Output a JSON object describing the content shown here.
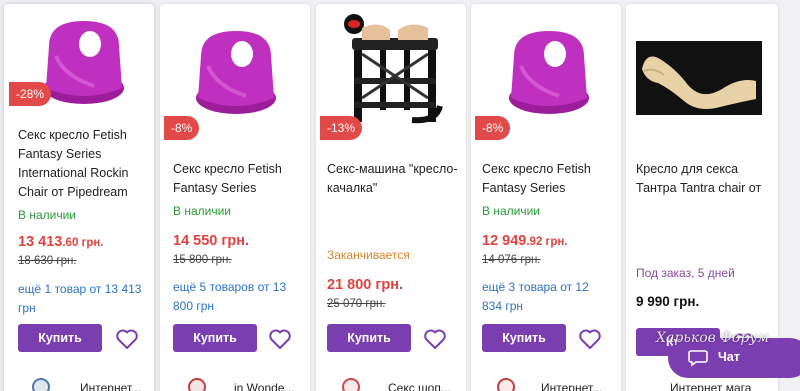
{
  "products": [
    {
      "badge": "-28%",
      "title": "Секс кресло Fetish Fantasy Series International Rockin Chair от Pipedream",
      "status": "В наличии",
      "price_main": "13 413",
      "price_cents": ".60 грн.",
      "old_price": "18 630 грн.",
      "offer": "ещё 1 товар от 13 413 грн",
      "buy_label": "Купить",
      "seller": "Интернет..."
    },
    {
      "badge": "-8%",
      "title": "Секс кресло Fetish Fantasy Series",
      "status": "В наличии",
      "price_main": "14 550 грн.",
      "old_price": "15 800 грн.",
      "offer": "ещё 5 товаров от 13 800 грн",
      "buy_label": "Купить",
      "seller": "in Wonde..."
    },
    {
      "badge": "-13%",
      "title": "Секс-машина \"кресло-качалка\"",
      "status": "Заканчивается",
      "price_main": "21 800 грн.",
      "old_price": "25 070 грн.",
      "buy_label": "Купить",
      "seller": "Секс шоп..."
    },
    {
      "badge": "-8%",
      "title": "Секс кресло Fetish Fantasy Series",
      "status": "В наличии",
      "price_main": "12 949",
      "price_cents": ".92 грн.",
      "old_price": "14 076 грн.",
      "offer": "ещё 3 товара от 12 834 грн",
      "buy_label": "Купить",
      "seller": "Интернет..."
    },
    {
      "title": "Кресло для секса Тантра Tantra chair от",
      "status": "Под заказ, 5 дней",
      "price_main": "9 990 грн.",
      "buy_label": "Ку...",
      "seller": "Интернет мага"
    }
  ],
  "chat_label": "Чат",
  "watermark": "Харьков Форум",
  "colors": {
    "accent": "#7a3eb1",
    "sale": "#e0433d",
    "in_stock": "#2a9a3a",
    "ending": "#d9842a"
  }
}
